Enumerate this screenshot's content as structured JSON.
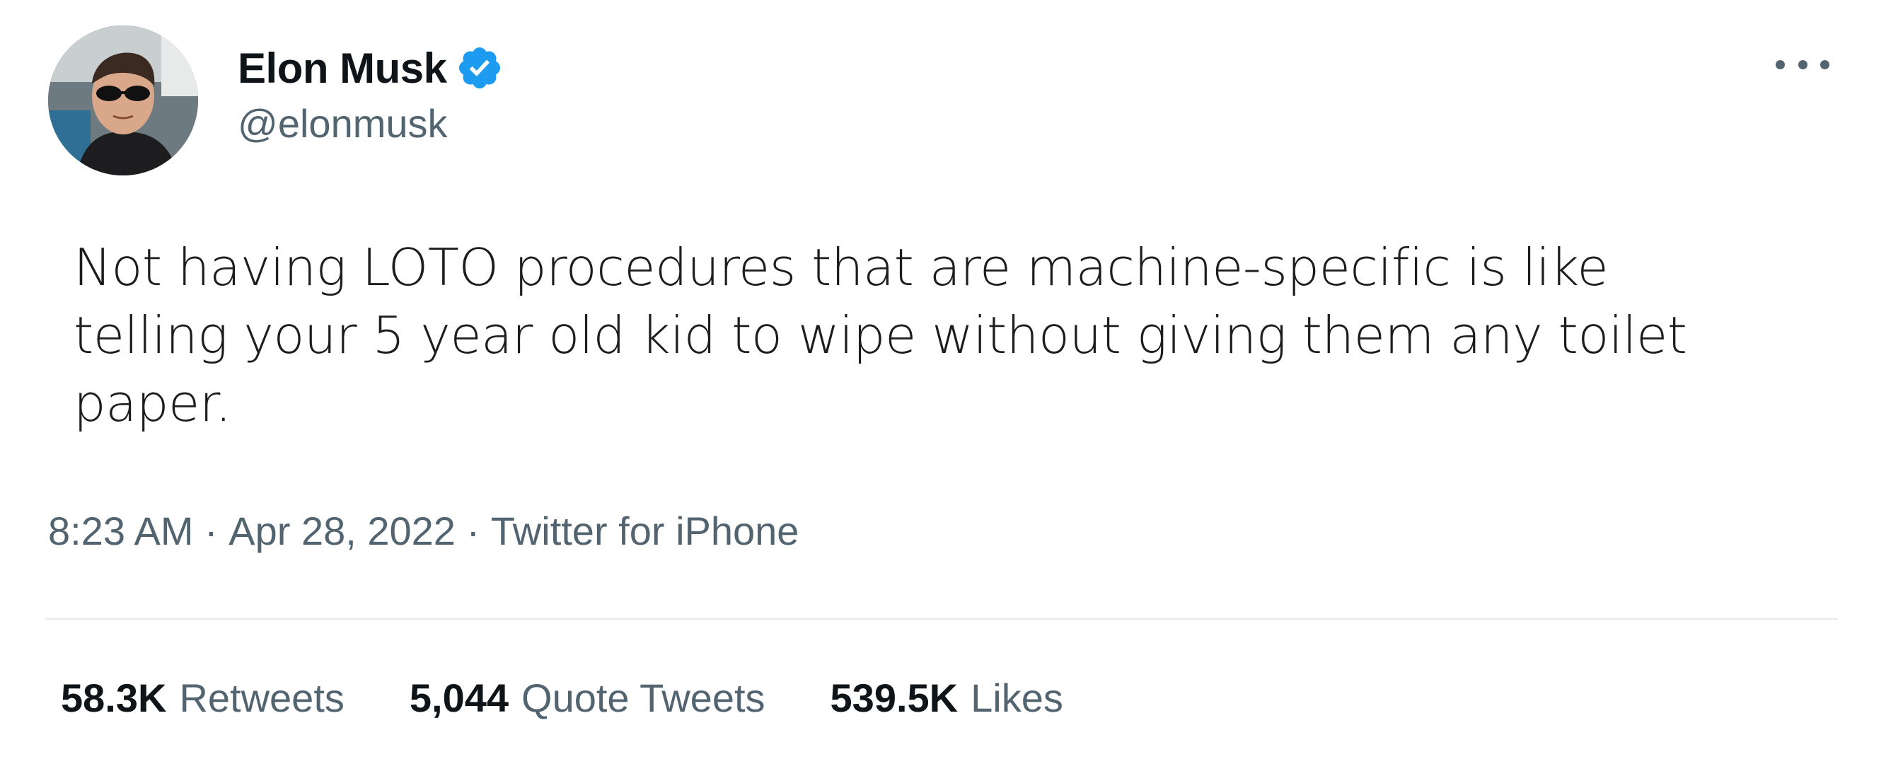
{
  "author": {
    "display_name": "Elon Musk",
    "handle": "@elonmusk",
    "verified": true,
    "avatar_icon": "profile-photo",
    "verified_color": "#1d9bf0"
  },
  "menu": {
    "icon": "more-horizontal-icon"
  },
  "tweet": {
    "text": "Not having LOTO procedures that are machine-specific is like telling your 5 year old kid to wipe without giving them any toilet paper."
  },
  "meta": {
    "time": "8:23 AM",
    "separator": " · ",
    "date": "Apr 28, 2022",
    "source": "Twitter for iPhone"
  },
  "stats": [
    {
      "value": "58.3K",
      "label": "Retweets"
    },
    {
      "value": "5,044",
      "label": "Quote Tweets"
    },
    {
      "value": "539.5K",
      "label": "Likes"
    }
  ]
}
